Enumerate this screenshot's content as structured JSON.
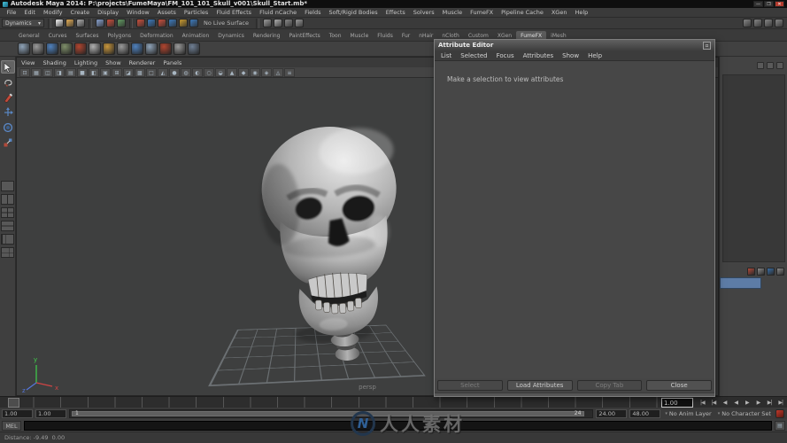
{
  "window": {
    "title": "Autodesk Maya 2014: P:\\projects\\FumeMaya\\FM_101_101_Skull_v001\\Skull_Start.mb*",
    "min_glyph": "—",
    "max_glyph": "❒",
    "close_glyph": "✕"
  },
  "menu_bar": {
    "items": [
      "File",
      "Edit",
      "Modify",
      "Create",
      "Display",
      "Window",
      "Assets",
      "Particles",
      "Fluid Effects",
      "Fluid nCache",
      "Fields",
      "Soft/Rigid Bodies",
      "Effects",
      "Solvers",
      "Muscle",
      "FumeFX",
      "Pipeline Cache",
      "XGen",
      "Help"
    ]
  },
  "status_line": {
    "menu_set": "Dynamics",
    "dropdown_caret": "▾",
    "live_surface_label": "No Live Surface",
    "file_icons": [
      {
        "name": "new-scene-icon",
        "color": "#d8d8d8"
      },
      {
        "name": "open-scene-icon",
        "color": "#c89a50"
      },
      {
        "name": "save-scene-icon",
        "color": "#9a9a9a"
      }
    ],
    "mask_icons": [
      {
        "name": "select-hierarchy-icon",
        "color": "#7a8fb5"
      },
      {
        "name": "select-object-icon",
        "color": "#b14a3a"
      },
      {
        "name": "select-component-icon",
        "color": "#5a8a5a"
      }
    ],
    "snap_icons": [
      {
        "name": "snap-grid-icon",
        "color": "#b14a3a"
      },
      {
        "name": "snap-curve-icon",
        "color": "#3a6ea5"
      },
      {
        "name": "snap-point-icon",
        "color": "#b14a3a"
      },
      {
        "name": "snap-plane-icon",
        "color": "#3a6ea5"
      },
      {
        "name": "snap-view-icon",
        "color": "#b1892f"
      },
      {
        "name": "make-live-icon",
        "color": "#3a6ea5"
      }
    ],
    "history_icons": [
      {
        "name": "construction-history-icon",
        "color": "#8a8a8a"
      },
      {
        "name": "render-current-frame-icon",
        "color": "#9a9a9a"
      },
      {
        "name": "ipr-render-icon",
        "color": "#7a7a7a"
      },
      {
        "name": "render-settings-icon",
        "color": "#888888"
      }
    ],
    "sidebar_icons": [
      {
        "name": "attribute-editor-toggle-icon",
        "color": "#787878"
      },
      {
        "name": "tool-settings-toggle-icon",
        "color": "#787878"
      },
      {
        "name": "channel-box-toggle-icon",
        "color": "#787878"
      },
      {
        "name": "modeling-toolkit-toggle-icon",
        "color": "#787878"
      }
    ]
  },
  "shelf": {
    "tabs": [
      {
        "label": "General"
      },
      {
        "label": "Curves"
      },
      {
        "label": "Surfaces"
      },
      {
        "label": "Polygons"
      },
      {
        "label": "Deformation"
      },
      {
        "label": "Animation"
      },
      {
        "label": "Dynamics"
      },
      {
        "label": "Rendering"
      },
      {
        "label": "PaintEffects"
      },
      {
        "label": "Toon"
      },
      {
        "label": "Muscle"
      },
      {
        "label": "Fluids"
      },
      {
        "label": "Fur"
      },
      {
        "label": "nHair"
      },
      {
        "label": "nCloth"
      },
      {
        "label": "Custom"
      },
      {
        "label": "XGen"
      },
      {
        "label": "FumeFX",
        "active": true
      },
      {
        "label": "iMesh"
      }
    ],
    "icons": [
      {
        "name": "shelf-icon-1",
        "color": "#8fa3b8"
      },
      {
        "name": "shelf-icon-2",
        "color": "#9a9a9a"
      },
      {
        "name": "shelf-icon-3",
        "color": "#4f81bd"
      },
      {
        "name": "shelf-icon-4",
        "color": "#7f8f6a"
      },
      {
        "name": "shelf-icon-5",
        "color": "#b1452f"
      },
      {
        "name": "shelf-icon-6",
        "color": "#b0b0b0"
      },
      {
        "name": "shelf-icon-7",
        "color": "#c8963c"
      },
      {
        "name": "shelf-icon-8",
        "color": "#9a9a9a"
      },
      {
        "name": "shelf-icon-9",
        "color": "#4f81bd"
      },
      {
        "name": "shelf-icon-10",
        "color": "#8fa3b8"
      },
      {
        "name": "shelf-icon-11",
        "color": "#b1452f"
      },
      {
        "name": "shelf-icon-12",
        "color": "#9a9a9a"
      },
      {
        "name": "shelf-icon-13",
        "color": "#6f7f94"
      }
    ]
  },
  "toolbox": {
    "tools": [
      {
        "title": "Select Tool"
      },
      {
        "title": "Lasso Tool"
      },
      {
        "title": "Paint Selection Tool"
      },
      {
        "title": "Move Tool"
      },
      {
        "title": "Rotate Tool"
      },
      {
        "title": "Scale Tool"
      }
    ],
    "layouts": [
      "Single Pane Layout",
      "Two Panes Side by Side",
      "Four View Layout",
      "Two Panes Stacked",
      "Persp/Outliner Layout",
      "Persp/Graph Layout"
    ]
  },
  "viewport": {
    "menus": [
      "View",
      "Shading",
      "Lighting",
      "Show",
      "Renderer",
      "Panels"
    ],
    "toolbar_icons": [
      "⊡",
      "▦",
      "◫",
      "◨",
      "▤",
      "■",
      "◧",
      "▣",
      "⊞",
      "◪",
      "▩",
      "□",
      "◭",
      "●",
      "◍",
      "◐",
      "○",
      "◒",
      "▲",
      "◆",
      "◉",
      "◈",
      "◬",
      "≡"
    ],
    "camera_label": "persp",
    "axis": {
      "x": "x",
      "y": "y",
      "z": "z"
    }
  },
  "attribute_editor": {
    "title": "Attribute Editor",
    "close_glyph": "▫",
    "menus": [
      "List",
      "Selected",
      "Focus",
      "Attributes",
      "Show",
      "Help"
    ],
    "message": "Make a selection to view attributes",
    "buttons": [
      {
        "label": "Select",
        "enabled": false
      },
      {
        "label": "Load Attributes",
        "enabled": true
      },
      {
        "label": "Copy Tab",
        "enabled": false
      },
      {
        "label": "Close",
        "enabled": true
      }
    ]
  },
  "channel_strip": {
    "layer_icons": [
      {
        "name": "new-layer-icon",
        "color": "#b14a3a"
      },
      {
        "name": "new-layer-empty-icon",
        "color": "#8a8a8a"
      },
      {
        "name": "layer-options-icon",
        "color": "#3a6ea5"
      },
      {
        "name": "layer-move-icon",
        "color": "#8a8a8a"
      }
    ],
    "selected_layer_color": "#5d7ca6"
  },
  "timeline": {
    "current_time": "1.00",
    "playback_buttons": [
      "|◀",
      "|◀",
      "◀",
      "◀",
      "▶",
      "▶",
      "▶|",
      "▶|"
    ]
  },
  "range_slider": {
    "anim_start": "1.00",
    "playback_start": "1.00",
    "bar_start": "1",
    "bar_end": "24",
    "playback_end": "24.00",
    "anim_end": "48.00",
    "anim_layer": "No Anim Layer",
    "character_set": "No Character Set",
    "caret": "▾"
  },
  "command_line": {
    "label": "MEL",
    "value": ""
  },
  "help_line": {
    "text": "Distance: -9.49  0.00"
  },
  "watermark": {
    "logo_letter": "N",
    "text": "人人素材"
  }
}
